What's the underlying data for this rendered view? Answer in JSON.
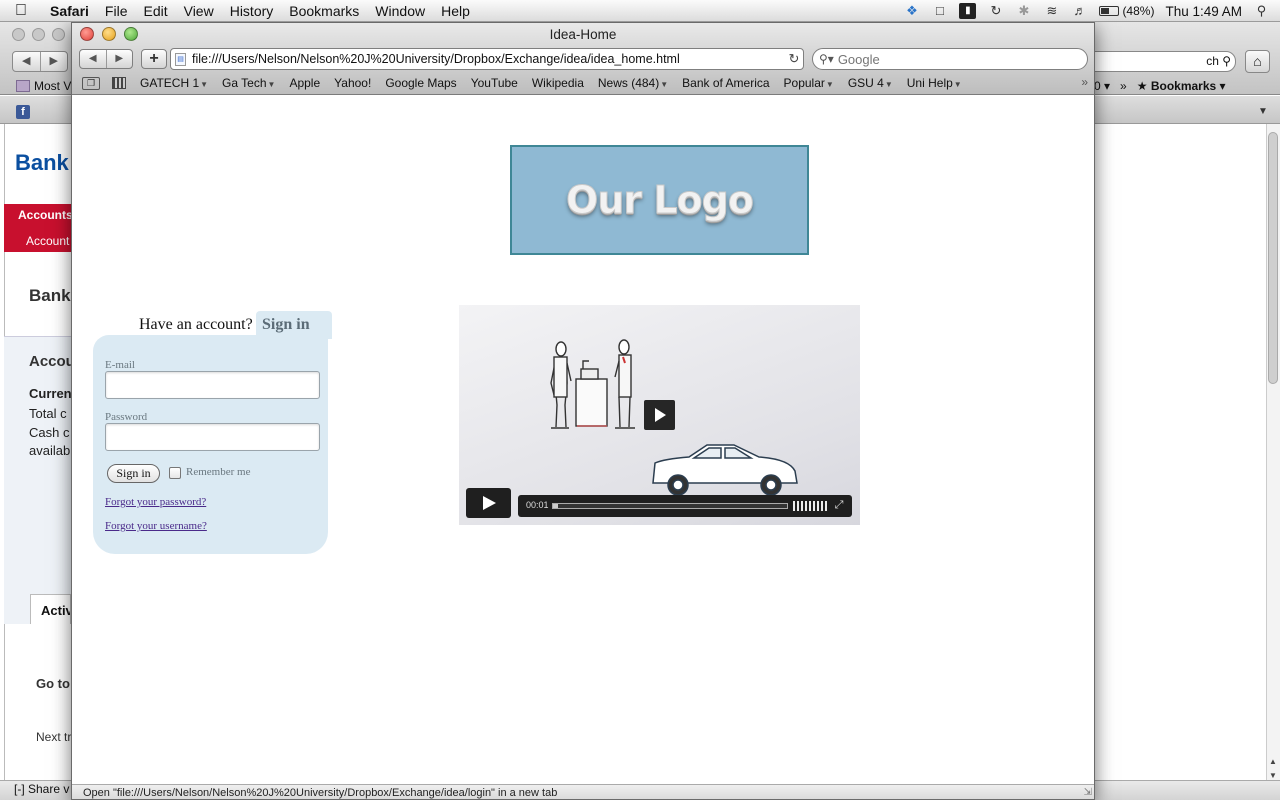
{
  "menubar": {
    "apple_icon": "apple-icon",
    "app_name": "Safari",
    "items": [
      "File",
      "Edit",
      "View",
      "History",
      "Bookmarks",
      "Window",
      "Help"
    ],
    "status_icons": [
      "dropbox-icon",
      "screen-capture-icon",
      "input-icon",
      "time-machine-icon",
      "bluetooth-icon",
      "wifi-icon",
      "volume-icon",
      "battery-icon"
    ],
    "battery": "(48%)",
    "clock": "Thu 1:49 AM",
    "spotlight_icon": "spotlight-icon"
  },
  "background_window": {
    "most_visited": "Most V",
    "bookmarks_partial": "0",
    "bookmarks_menu": "Bookmarks",
    "search_suffix": "ch",
    "bank_name": "Bank",
    "accounts_tab": "Accounts",
    "accounts_sub": "Account",
    "heading": "Bank",
    "panel_heading": "Accou",
    "lines": [
      "Curren",
      "Total c",
      "Cash c",
      "availab"
    ],
    "active_tab": "Activ",
    "goto": "Go to:",
    "next": "Next tr",
    "share": "Share v"
  },
  "window": {
    "title": "Idea-Home",
    "address": "file:///Users/Nelson/Nelson%20J%20University/Dropbox/Exchange/idea/idea_home.html",
    "search_placeholder": "Google",
    "bookmarks": [
      {
        "label": "GATECH 1",
        "menu": true
      },
      {
        "label": "Ga Tech",
        "menu": true
      },
      {
        "label": "Apple",
        "menu": false
      },
      {
        "label": "Yahoo!",
        "menu": false
      },
      {
        "label": "Google Maps",
        "menu": false
      },
      {
        "label": "YouTube",
        "menu": false
      },
      {
        "label": "Wikipedia",
        "menu": false
      },
      {
        "label": "News (484)",
        "menu": true
      },
      {
        "label": "Bank of America",
        "menu": false
      },
      {
        "label": "Popular",
        "menu": true
      },
      {
        "label": "GSU 4",
        "menu": true
      },
      {
        "label": "Uni Help",
        "menu": true
      }
    ],
    "status_text": "Open \"file:///Users/Nelson/Nelson%20J%20University/Dropbox/Exchange/idea/login\" in a new tab"
  },
  "page": {
    "logo_text": "Our Logo",
    "signin": {
      "prompt": "Have an account?",
      "tab_label": "Sign in",
      "email_label": "E-mail",
      "email_value": "",
      "password_label": "Password",
      "password_value": "",
      "button": "Sign in",
      "remember": "Remember me",
      "remember_checked": false,
      "forgot_password": "Forgot your password?",
      "forgot_username": "Forgot your username?"
    },
    "video": {
      "time": "00:01",
      "progress": 0.01
    }
  }
}
